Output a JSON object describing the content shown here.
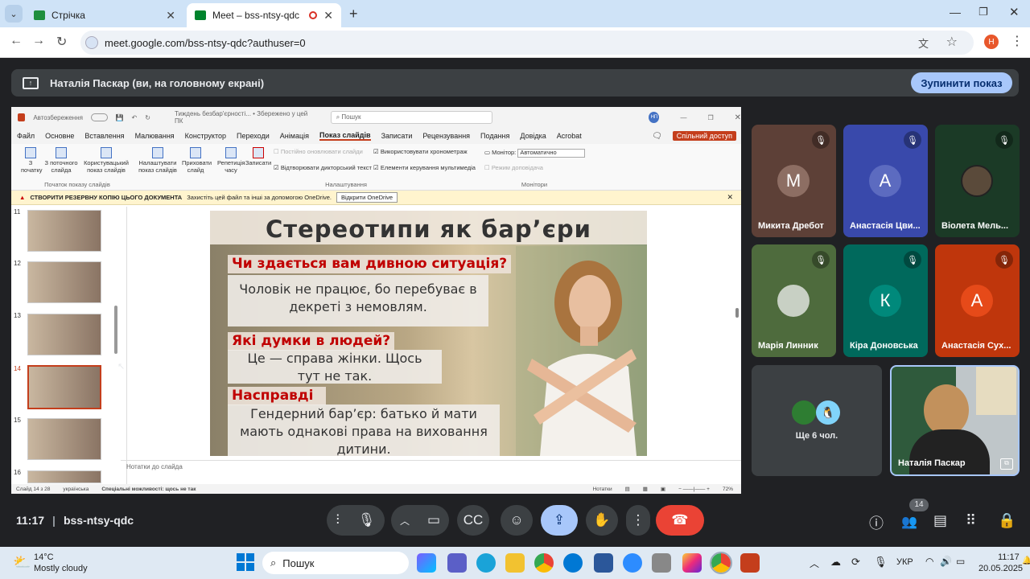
{
  "browser": {
    "tabs": [
      {
        "title": "Стрічка"
      },
      {
        "title": "Meet – bss-ntsy-qdc"
      }
    ],
    "url": "meet.google.com/bss-ntsy-qdc?authuser=0",
    "profile_initial": "Н"
  },
  "meet": {
    "share_banner": "Наталія Паскар (ви, на головному екрані)",
    "stop_button": "Зупинити показ",
    "time": "11:17",
    "meeting_code": "bss-ntsy-qdc",
    "participant_count": "14",
    "others": "Ще 6 чол.",
    "participants": [
      {
        "name": "Микита Дребот",
        "initial": "М",
        "color": "#8d6e63"
      },
      {
        "name": "Анастасія Цви...",
        "initial": "А",
        "color": "#5c6bc0"
      },
      {
        "name": "Віолета Мель...",
        "initial": "",
        "color": "#1b3a26"
      },
      {
        "name": "Марія Линник",
        "initial": "",
        "color": "#4e6b3d"
      },
      {
        "name": "Кіра Доновська",
        "initial": "К",
        "color": "#00897b"
      },
      {
        "name": "Анастасія Сух...",
        "initial": "А",
        "color": "#e64a19"
      }
    ],
    "self_name": "Наталія Паскар"
  },
  "ppt": {
    "autosave": "Автозбереження",
    "doc_title": "Тиждень безбар'єрності...  •  Збережено у цей ПК",
    "search": "Пошук",
    "share_button": "Спільний доступ",
    "menu": [
      "Файл",
      "Основне",
      "Вставлення",
      "Малювання",
      "Конструктор",
      "Переходи",
      "Анімація",
      "Показ слайдів",
      "Записати",
      "Рецензування",
      "Подання",
      "Довідка",
      "Acrobat"
    ],
    "ribbon": {
      "from_start": "З початку",
      "from_current": "З поточного слайда",
      "custom": "Користувацький показ слайдів",
      "group1": "Початок показу слайдів",
      "rehearse": "Налаштувати показ слайдів",
      "hide": "Приховати слайд",
      "timings": "Репетиція часу",
      "record": "Записати",
      "cb1": "Постійно оновлювати слайди",
      "cb2": "Відтворювати дикторський текст",
      "cb3": "Використовувати хронометраж",
      "cb4": "Елементи керування мультимедіа",
      "group2": "Налаштування",
      "monitor_label": "Монітор:",
      "monitor_value": "Автоматично",
      "presenter": "Режим доповідача",
      "group3": "Монітори"
    },
    "backup_bar": {
      "title": "СТВОРИТИ РЕЗЕРВНУ КОПІЮ ЦЬОГО ДОКУМЕНТА",
      "text": "Захистіть цей файл та інші за допомогою OneDrive.",
      "button": "Відкрити OneDrive"
    },
    "slide_numbers": [
      "11",
      "12",
      "13",
      "14",
      "15",
      "16"
    ],
    "notes": "Нотатки до слайда",
    "status": {
      "slide": "Слайд 14 з 28",
      "lang": "українська",
      "accessibility": "Спеціальні можливості: щось не так",
      "notes": "Нотатки",
      "zoom": "72%"
    },
    "slide": {
      "title": "Стереотипи як бар’єри",
      "q1": "Чи здається вам дивною ситуація?",
      "a1": "Чоловік не працює, бо перебуває в декреті з немовлям.",
      "q2": "Які думки в людей?",
      "a2": "Це — справа жінки. Щось тут не так.",
      "q3": "Насправді",
      "a3": "Гендерний бар’єр: батько й мати мають однакові права на виховання дитини."
    }
  },
  "taskbar": {
    "temp": "14°C",
    "weather": "Mostly cloudy",
    "search": "Пошук",
    "lang": "УКР",
    "time": "11:17",
    "date": "20.05.2025"
  }
}
